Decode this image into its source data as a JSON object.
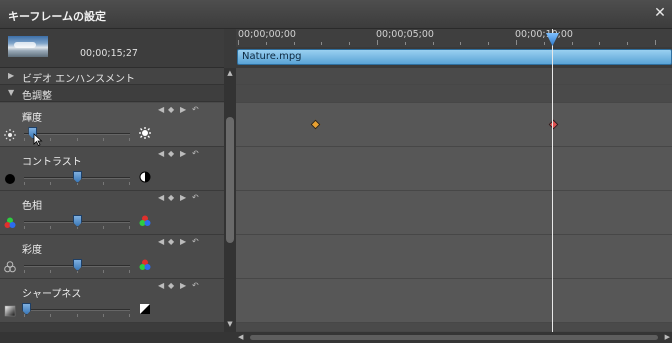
{
  "window": {
    "title": "キーフレームの設定",
    "close_glyph": "✕"
  },
  "preview": {
    "timecode": "00;00;15;27"
  },
  "groups": [
    {
      "label": "ビデオ エンハンスメント",
      "arrow": "▶"
    },
    {
      "label": "色調整",
      "arrow": "▼"
    }
  ],
  "properties": [
    {
      "name": "輝度",
      "left_icon": "sun-small-icon",
      "right_icon": "sun-large-icon",
      "level": 0.08
    },
    {
      "name": "コントラスト",
      "left_icon": "black-circle-icon",
      "right_icon": "half-circle-icon",
      "level": 0.5
    },
    {
      "name": "色相",
      "left_icon": "rgb-circles-icon",
      "right_icon": "rgb-circles-icon",
      "level": 0.5
    },
    {
      "name": "彩度",
      "left_icon": "gray-circles-icon",
      "right_icon": "rgb-circles-icon",
      "level": 0.5
    },
    {
      "name": "シャープネス",
      "left_icon": "gradient-square-icon",
      "right_icon": "sharp-square-icon",
      "level": 0.02
    }
  ],
  "keyframe_controls": {
    "prev": "◀",
    "add": "◆",
    "next": "▶",
    "reset": "↶"
  },
  "timeline": {
    "ruler_labels": [
      "00;00;00;00",
      "00;00;05;00",
      "00;00;10;00"
    ],
    "clip_name": "Nature.mpg",
    "keyframes_brightness": [
      {
        "color": "#e8a030"
      },
      {
        "color": "#e05050"
      }
    ]
  },
  "colors": {
    "accent": "#5aa3d6",
    "playhead": "#3c8ce0"
  }
}
